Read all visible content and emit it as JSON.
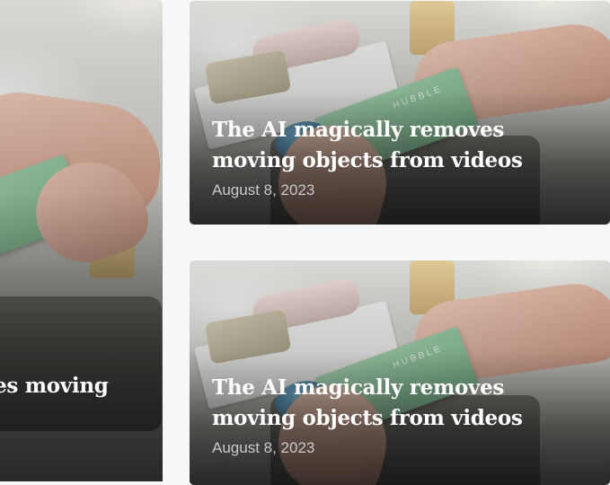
{
  "posts": [
    {
      "title": "The AI magically removes moving objects from videos",
      "date": "August 8, 2023"
    },
    {
      "title": "The AI magically removes moving objects from videos",
      "date": "August 8, 2023"
    },
    {
      "title_visible_fragment": "ves moving"
    }
  ],
  "colors": {
    "page_background": "#f6f7f9",
    "title": "#ffffff",
    "date": "#c9c9c9"
  },
  "icons": []
}
